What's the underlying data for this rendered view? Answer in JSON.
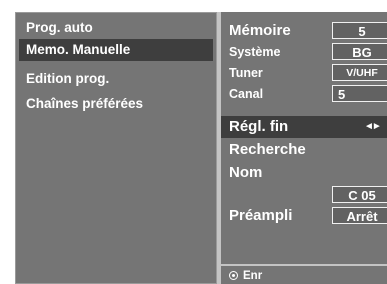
{
  "menu": {
    "items": [
      {
        "label": "Prog. auto",
        "selected": false
      },
      {
        "label": "Memo. Manuelle",
        "selected": true
      },
      {
        "label": "Edition prog.",
        "selected": false
      },
      {
        "label": "Chaînes préférées",
        "selected": false
      }
    ]
  },
  "settings": {
    "memoire": {
      "label": "Mémoire",
      "value": "5"
    },
    "systeme": {
      "label": "Système",
      "value": "BG"
    },
    "tuner": {
      "label": "Tuner",
      "value": "V/UHF"
    },
    "canal": {
      "label": "Canal",
      "value": "5"
    },
    "reglage_fin": {
      "label": "Régl. fin",
      "value": "◄►",
      "selected": true
    },
    "recherche": {
      "label": "Recherche"
    },
    "nom": {
      "label": "Nom",
      "value": "C 05"
    },
    "preampli": {
      "label": "Préampli",
      "value": "Arrêt"
    }
  },
  "footer": {
    "save_label": "Enr",
    "icon": "radio-button-icon"
  },
  "colors": {
    "panel": "#757575",
    "selected": "#3e3e3e",
    "divider": "#c4c4c4",
    "text": "#ffffff"
  }
}
